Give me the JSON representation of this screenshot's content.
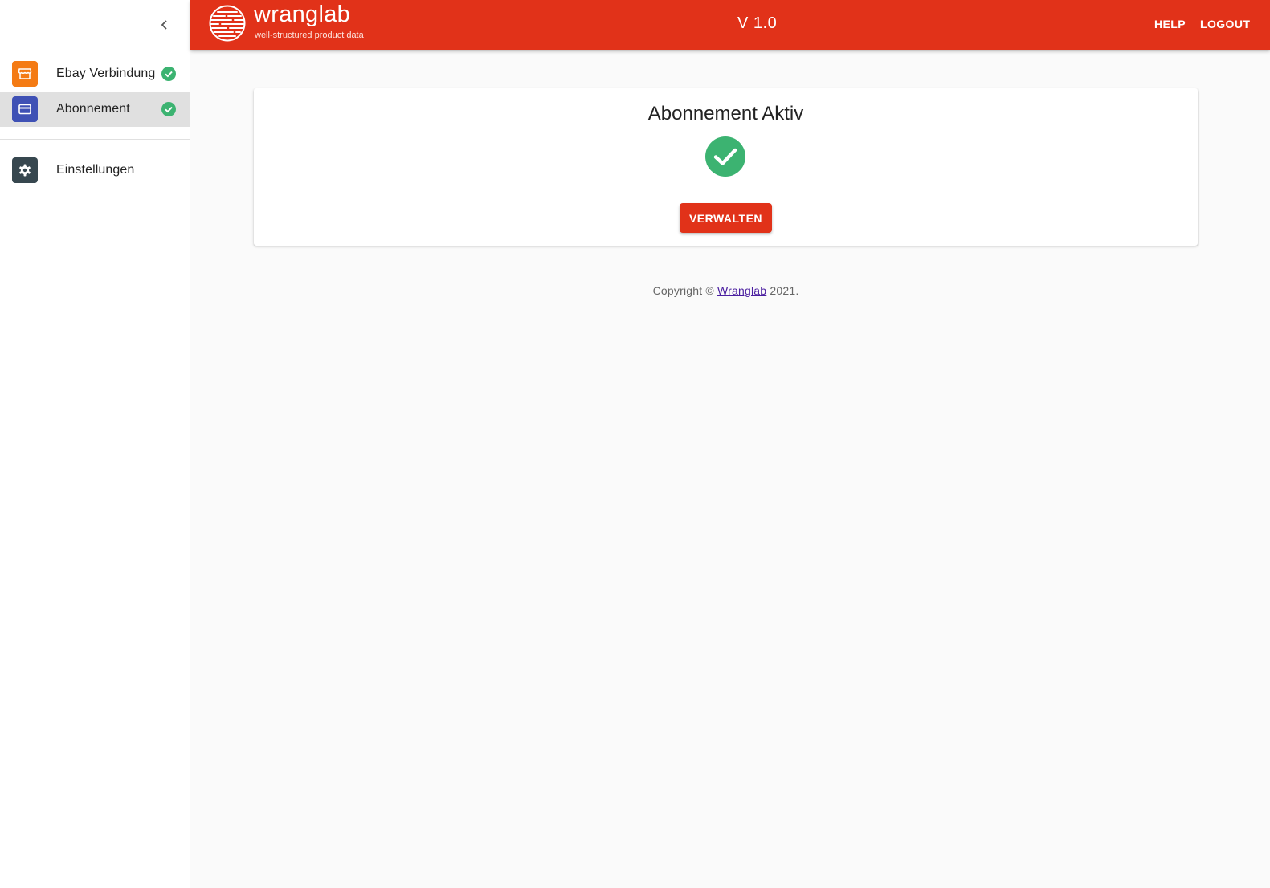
{
  "colors": {
    "brand": "#e13219",
    "success": "#3cb371",
    "ebay_icon_bg": "#f47b14",
    "subscription_icon_bg": "#3f51b5",
    "settings_icon_bg": "#37474f"
  },
  "sidebar": {
    "collapse_icon": "chevron-left-icon",
    "items": [
      {
        "label": "Ebay Verbindung",
        "icon": "storefront-icon",
        "status": "check-circle-icon",
        "active": false
      },
      {
        "label": "Abonnement",
        "icon": "credit-card-icon",
        "status": "check-circle-icon",
        "active": true
      },
      {
        "label": "Einstellungen",
        "icon": "gear-icon",
        "active": false
      }
    ]
  },
  "header": {
    "logo_name": "wranglab",
    "logo_tagline": "well-structured product data",
    "version": "V 1.0",
    "help_label": "HELP",
    "logout_label": "LOGOUT"
  },
  "main": {
    "card": {
      "title": "Abonnement Aktiv",
      "status_icon": "check-circle-icon",
      "button_label": "VERWALTEN"
    },
    "footer": {
      "prefix": "Copyright © ",
      "link_text": "Wranglab",
      "suffix": " 2021."
    }
  }
}
